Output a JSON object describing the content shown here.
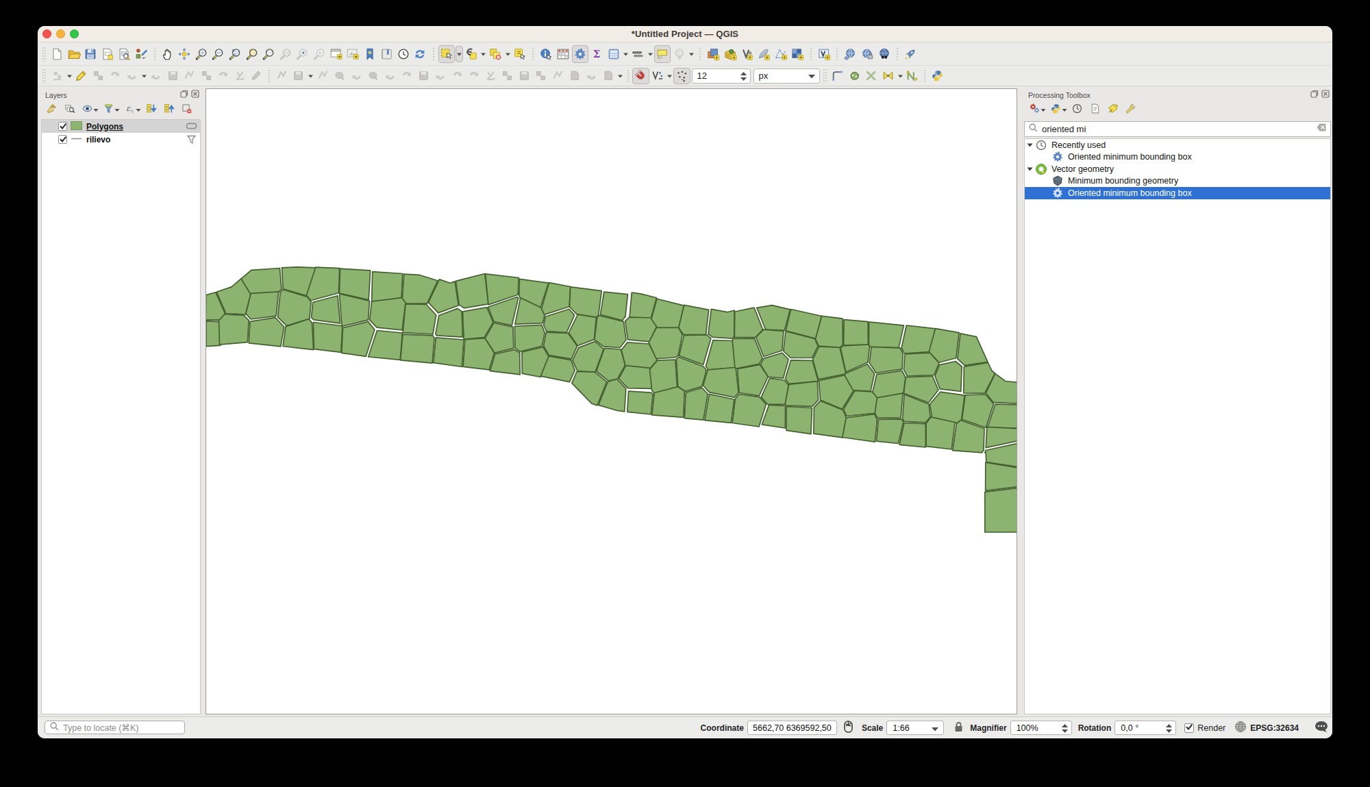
{
  "window": {
    "title": "*Untitled Project — QGIS"
  },
  "traffic_lights": [
    "close",
    "minimize",
    "zoom"
  ],
  "toolbar1": {
    "groups": [
      [
        {
          "icon": "file-new"
        },
        {
          "icon": "folder-open"
        },
        {
          "icon": "save"
        },
        {
          "icon": "new-layout"
        },
        {
          "icon": "layout-manager"
        },
        {
          "icon": "style-manager"
        }
      ],
      [
        {
          "icon": "pan-hand"
        },
        {
          "icon": "pan-selection"
        },
        {
          "icon": "zoom-in"
        },
        {
          "icon": "zoom-out"
        },
        {
          "icon": "zoom-full"
        },
        {
          "icon": "zoom-selection"
        },
        {
          "icon": "zoom-layer"
        },
        {
          "icon": "zoom-native"
        },
        {
          "icon": "zoom-last"
        },
        {
          "icon": "zoom-next"
        },
        {
          "icon": "new-map-view"
        },
        {
          "icon": "new-3d-view"
        },
        {
          "icon": "bookmark"
        },
        {
          "icon": "bookmark-book"
        },
        {
          "icon": "temporal-clock"
        },
        {
          "icon": "refresh"
        }
      ],
      [
        {
          "icon": "select-rect",
          "drop": true,
          "pressed": true
        },
        {
          "icon": "select-expression",
          "drop": true
        },
        {
          "icon": "deselect",
          "drop": true
        },
        {
          "icon": "select-value"
        }
      ],
      [
        {
          "icon": "identify"
        },
        {
          "icon": "attr-table"
        },
        {
          "icon": "processing-gear",
          "pressed": true
        },
        {
          "icon": "stats-sigma"
        },
        {
          "icon": "calc-table",
          "drop": true
        },
        {
          "icon": "measure",
          "drop": true
        },
        {
          "icon": "map-tips",
          "pressed": true
        },
        {
          "icon": "annotation-gray",
          "drop": true
        }
      ],
      [
        {
          "icon": "datasource"
        },
        {
          "icon": "new-gpkg"
        },
        {
          "icon": "new-shapefile"
        },
        {
          "icon": "new-spatialite"
        },
        {
          "icon": "new-mesh"
        },
        {
          "icon": "new-raster"
        }
      ],
      [
        {
          "icon": "new-virtual"
        }
      ],
      [
        {
          "icon": "web-layers"
        },
        {
          "icon": "web-lock"
        },
        {
          "icon": "web-search"
        }
      ],
      [
        {
          "icon": "plugin-rocket"
        }
      ]
    ]
  },
  "toolbar2": {
    "groups1": [
      [
        {
          "icon": "edits-current",
          "drop": true
        },
        {
          "icon": "edit-pencil"
        },
        {
          "icon": "save-edits-gray"
        },
        {
          "icon": "digitize-gray"
        },
        {
          "icon": "vertex-gray",
          "drop": true
        },
        {
          "icon": "form-gray"
        },
        {
          "icon": "paste-gray"
        },
        {
          "icon": "cut-gray"
        },
        {
          "icon": "copy2-gray"
        },
        {
          "icon": "paste2-gray"
        },
        {
          "icon": "undo-gray"
        },
        {
          "icon": "redo-gray"
        }
      ],
      [
        {
          "icon": "chart-gray"
        },
        {
          "icon": "curve-gray",
          "drop": true
        },
        {
          "icon": "reshape-gray"
        },
        {
          "icon": "split-gray"
        },
        {
          "icon": "splitparts-gray"
        },
        {
          "icon": "trim-gray"
        },
        {
          "icon": "merge-gray"
        },
        {
          "icon": "mergeattr-gray"
        },
        {
          "icon": "rotate-gray"
        },
        {
          "icon": "extend-gray"
        },
        {
          "icon": "simplify-gray"
        },
        {
          "icon": "addring-gray"
        },
        {
          "icon": "addpart-gray"
        },
        {
          "icon": "swap-gray"
        },
        {
          "icon": "fillring-gray"
        },
        {
          "icon": "delring-gray"
        },
        {
          "icon": "delpart-gray"
        },
        {
          "icon": "offset-gray"
        },
        {
          "icon": "regular-gray"
        },
        {
          "icon": "move-gray",
          "drop": true
        }
      ],
      [
        {
          "icon": "magnet",
          "pressed": true
        },
        {
          "icon": "snap-type",
          "drop": true
        },
        {
          "icon": "snap-dots",
          "pressed": true
        }
      ]
    ],
    "tolerance_value": "12",
    "units_value": "px",
    "groups2": [
      [
        {
          "icon": "topo-branch"
        },
        {
          "icon": "topo-blob"
        },
        {
          "icon": "topo-x"
        },
        {
          "icon": "topo-bowtie",
          "drop": true
        },
        {
          "icon": "topo-n"
        }
      ],
      [
        {
          "icon": "python-plugin"
        }
      ]
    ]
  },
  "layers_panel": {
    "title": "Layers",
    "toolbar": [
      {
        "icon": "broom-styling"
      },
      {
        "icon": "add-group"
      },
      {
        "icon": "eye-themes",
        "drop": true
      },
      {
        "icon": "filter-funnel",
        "drop": true
      },
      {
        "icon": "filter-expression",
        "drop": true
      },
      {
        "icon": "expand-all"
      },
      {
        "icon": "collapse-all"
      },
      {
        "icon": "remove-layer"
      }
    ],
    "rows": [
      {
        "label": "Polygons",
        "checked": true,
        "symbol": "polygon-swatch",
        "indicator": "memory-indicator",
        "selected": true,
        "underline": true
      },
      {
        "label": "rilievo",
        "checked": true,
        "symbol": "line-swatch",
        "indicator": "filter-indicator",
        "selected": false,
        "underline": false
      }
    ]
  },
  "toolbox_panel": {
    "title": "Processing Toolbox",
    "toolbar": [
      {
        "icon": "models-gears",
        "drop": true
      },
      {
        "icon": "python-small",
        "drop": true
      },
      {
        "icon": "history-clock"
      },
      {
        "icon": "results-doc"
      },
      {
        "icon": "edit-tag"
      },
      {
        "icon": "wrench"
      }
    ],
    "search": {
      "value": "oriented mi"
    },
    "tree": [
      {
        "kind": "group",
        "icon": "clock-small",
        "label": "Recently used",
        "expanded": true
      },
      {
        "kind": "alg",
        "icon": "alg-gear",
        "label": "Oriented minimum bounding box"
      },
      {
        "kind": "group",
        "icon": "qgis-logo",
        "label": "Vector geometry",
        "expanded": true
      },
      {
        "kind": "alg",
        "icon": "min-geom",
        "label": "Minimum bounding geometry"
      },
      {
        "kind": "alg",
        "icon": "alg-gear-sel",
        "label": "Oriented minimum bounding box",
        "selected": true
      }
    ]
  },
  "map": {
    "fill": "#8db370",
    "stroke": "#44602f",
    "stroke_width": 1.7,
    "stones": [
      "313.9,426.8 299.8,430.8 299.2,467.1 319.5,467.2 327.8,458.2",
      "319.5,469.7 299.9,468.9 299.9,505.7 320.5,504.4",
      "351.2,406.7 337.0,418.9 315.1,426.2 328.8,457.5 357.4,459.1 364.9,429.0",
      "362.2,467.6 355.0,460.3 326.8,459.0 318.5,468.0 319.5,503.2 360.4,499.7",
      "410.0,421.8 407.4,391.5 365.8,394.4 351.1,406.9 364.5,429.0 405.4,426.8",
      "405.7,425.9 365.2,428.4 358.0,458.1 365.1,466.0 402.1,461.4",
      "413.7,477.3 401.3,463.7 364.0,469.3 362.2,500.8 408.7,505.8",
      "412.3,421.7 446.9,431.9 460.2,390.8 432.9,389.9 410.4,390.9",
      "417.3,475.6 450.8,465.4 453.2,440.8 447.6,433.4 412.3,422.6 408.1,427.0 404.5,462.9",
      "454.5,471.4 450.1,465.8 416.0,476.9 412.0,505.5 456.6,510.7",
      "446.4,431.0 452.8,438.7 493.4,427.7 494.7,391.6 459.9,390.1",
      "455.8,441.3 453.5,463.6 456.9,466.8 495.6,472.2 492.0,431.7",
      "456.3,470.5 457.4,509.7 496.8,514.4 498.8,477.7 497.1,475.5",
      "537.2,437.8 539.6,394.9 495.5,392.2 494.4,428.1",
      "494.5,429.0 498.0,475.1 499.3,476.2 536.6,467.1 538.4,439.4",
      "497.8,515.4 533.2,520.3 545.9,481.2 536.6,469.6 499.4,478.6",
      "585.1,434.8 586.8,399.5 542.7,396.6 541.6,441.1",
      "538.7,467.2 549.1,478.2 586.1,481.8 591.1,441.4 586.0,434.6 541.6,440.1",
      "549.4,482.5 536.6,521.0 583.2,525.4 586.4,486.0",
      "586.4,435.8 591.6,442.8 622.5,443.1 638.0,409.7 610.8,401.3 588.7,400.1",
      "621.5,444.5 591.1,443.9 587.1,485.6 630.9,488.0 635.7,460.0",
      "583.6,525.8 630.1,530.2 633.1,493.6 630.8,489.8 587.0,488.1",
      "624.4,441.6 638.7,456.9 668.4,446.0 663.0,410.9 656.2,413.3 640.4,407.9",
      "639.7,460.5 634.8,487.9 636.6,489.9 674.3,492.2 673.2,454.9 667.1,450.4",
      "676.0,496.0 635.2,492.8 631.8,529.6 673.4,535.5",
      "676.4,449.9 711.9,443.8 706.8,399.5 664.4,410.4 669.3,445.1",
      "709.8,448.6 674.5,454.8 676.1,495.4 705.9,492.7 719.0,470.8",
      "720.5,515.2 706.9,493.6 677.9,495.7 675.0,535.4 713.2,539.8",
      "756.2,405.5 707.6,399.9 712.0,444.9 755.2,430.3",
      "754.1,433.5 711.6,448.3 720.0,469.7 746.2,475.2 755.6,435.6",
      "719.8,471.5 707.2,493.9 721.2,515.4 748.8,508.4 747.9,477.4",
      "757.7,514.9 750.3,510.4 721.7,517.0 714.4,541.6 758.2,546.8",
      "787.9,449.0 799.8,413.2 757.4,407.4 756.8,431.8 758.0,434.9",
      "794.4,458.6 789.0,449.3 758.8,434.7 750.8,473.4 791.3,471.7",
      "750.3,476.4 750.9,508.1 758.4,513.2 790.4,505.2 794.2,486.1 789.9,474.4",
      "761.3,545.3 788.4,550.5 800.2,520.7 791.9,506.7 760.9,514.0",
      "831.7,418.5 800.5,412.7 789.6,450.7 793.5,459.4 830.1,447.8",
      "796.6,483.7 826.2,485.5 837.6,460.1 829.8,451.2 795.2,462.3 792.6,474.5",
      "792.5,505.0 800.5,518.6 833.2,524.1 841.6,505.3 828.4,486.4 796.4,485.1",
      "838.3,540.5 832.5,525.7 800.2,519.8 788.4,549.1 830.5,557.7",
      "877.3,424.7 831.8,418.9 830.4,448.0 840.8,458.6 869.0,463.1 872.5,461.1",
      "869.5,463.5 842.4,459.1 829.3,485.9 842.3,504.7 866.4,495.6",
      "843.6,507.6 834.7,526.4 842.1,541.7 867.9,543.2 880.3,509.6 867.7,498.4",
      "833.8,559.4 862.7,589.2 870.9,591.9 884.8,557.4 867.2,543.2 841.0,542.5",
      "875.4,459.2 907.3,467.8 912.0,462.4 915.4,429.6 880.8,426.1",
      "874.0,460.6 871.0,462.4 866.9,495.6 879.9,505.9 904.2,507.5 913.0,496.3 909.4,469.3",
      "881.5,508.3 869.5,542.0 887.3,556.2 900.6,553.0 911.6,533.1 905.2,510.0",
      "912.8,567.3 899.7,553.5 886.4,557.3 872.6,591.4 900.1,599.5 910.7,600.9",
      "957.5,434.8 935.3,429.1 921.3,427.2 918.0,463.3 949.4,464.2",
      "950.0,464.0 917.7,463.1 911.7,468.9 915.5,495.9 946.9,498.8 957.6,476.5",
      "914.9,499.9 906.2,510.9 912.2,534.6 947.3,538.7 958.3,525.7 946.4,502.0",
      "902.2,552.9 915.6,566.7 951.0,567.4 947.9,537.4 912.8,533.6",
      "952.2,575.8 949.4,573.2 916.5,571.2 914.8,601.4 949.3,605.0",
      "989.7,478.6 997.4,446.1 958.0,436.2 949.9,465.8 958.5,478.4",
      "946.1,499.9 957.1,523.6 984.5,522.0 989.0,519.6 995.2,488.6 989.5,478.3 957.5,478.3",
      "947.5,539.4 950.7,570.0 953.8,574.3 987.6,565.4 984.8,525.2 958.6,526.1",
      "988.4,564.6 954.2,573.5 950.8,605.8 996.9,609.3 998.2,570.8",
      "989.8,478.5 996.7,488.5 1029.6,488.6 1033.7,452.4 997.7,445.3",
      "1025.7,532.5 1036.9,493.9 1030.6,488.9 997.5,489.6 990.4,519.3",
      "986.4,524.2 988.7,564.1 999.7,571.4 1023.8,564.1 1030.2,540.5 1026.1,535.3 990.2,521.2",
      "1000.1,573.3 998.3,610.7 1025.9,613.2 1032.2,575.0 1023.8,566.1",
      "1032.9,487.7 1039.5,492.4 1068.2,494.1 1070.7,491.6 1071.1,453.0 1060.7,455.7 1037.4,451.4",
      "1029.3,535.0 1033.2,540.1 1073.0,536.7 1068.2,497.5 1039.9,496.7",
      "1072.0,536.5 1032.3,539.8 1025.4,562.7 1034.2,572.6 1071.1,580.1 1077.1,573.2 1073.2,537.2",
      "1070.8,583.0 1034.4,575.3 1027.8,613.6 1066.4,617.3",
      "1100.1,449.2 1071.7,455.0 1071.3,492.7 1101.9,492.6 1112.6,481.1",
      "1069.6,494.3 1068.2,496.9 1071.9,536.7 1073.5,538.2 1107.2,531.3 1112.0,522.7 1100.4,494.1",
      "1108.4,532.3 1075.5,538.7 1078.1,573.5 1107.3,577.9 1120.2,550.1",
      "1117.4,590.3 1107.9,579.6 1077.7,575.5 1072.3,582.6 1068.1,617.5 1107.0,623.0",
      "1116.5,481.0 1144.3,482.3 1152.4,451.9 1125.9,445.6 1103.8,449.3",
      "1143.0,483.5 1113.9,481.1 1102.4,492.3 1113.9,520.5 1140.5,512.0",
      "1140.7,515.2 1113.7,523.4 1109.2,532.3 1120.6,550.3 1142.4,552.1 1150.2,524.6",
      "1144.1,555.0 1122.5,552.3 1110.3,579.9 1119.3,590.2 1145.3,590.3 1150.2,562.7",
      "1121.6,591.1 1111.3,619.8 1145.3,625.0 1145.5,592.4",
      "1146.0,482.9 1189.8,494.4 1198.5,461.5 1153.7,451.5",
      "1145.9,483.8 1142.6,512.5 1153.0,522.4 1184.5,522.5 1193.1,505.2 1188.7,494.8",
      "1193.5,556.5 1185.0,526.3 1153.5,525.9 1145.3,553.1 1150.6,560.4",
      "1150.5,561.3 1145.2,589.7 1147.3,592.2 1184.7,593.3 1193.5,584.1 1192.3,556.7",
      "1184.5,595.5 1147.1,593.5 1147.0,628.4 1182.9,633.6",
      "1229.0,465.1 1198.8,461.3 1189.4,495.1 1194.1,505.1 1225.2,507.4 1229.4,503.5",
      "1233.4,543.5 1225.0,507.5 1194.7,506.0 1185.5,524.7 1193.7,553.9 1232.5,546.2",
      "1232.3,547.7 1194.4,555.7 1196.5,584.1 1228.5,597.2 1245.3,570.0",
      "1234.3,609.7 1229.8,598.8 1196.7,585.2 1187.4,594.7 1186.8,633.2 1229.1,638.9",
      "1266.4,503.2 1266.2,469.6 1231.0,466.7 1230.5,504.0",
      "1226.1,507.9 1233.8,543.2 1266.0,529.0 1268.6,505.6 1266.8,503.0 1230.1,504.9",
      "1269.9,571.2 1275.6,545.5 1265.4,531.7 1233.2,545.2 1231.7,547.4 1244.4,569.9",
      "1230.2,597.7 1235.0,607.5 1276.4,603.4 1280.2,580.2 1272.0,571.9 1247.1,570.3",
      "1279.5,612.2 1275.6,604.7 1234.2,609.8 1228.8,638.5 1276.3,645.1",
      "1267.4,503.7 1269.3,506.3 1311.1,507.6 1318.4,475.1 1267.5,470.0",
      "1277.9,544.5 1315.9,538.9 1317.3,516.6 1313.2,508.1 1271.0,506.5 1268.2,529.8",
      "1272.8,572.3 1280.0,581.2 1317.8,574.3 1320.9,551.0 1315.8,541.1 1278.8,546.7",
      "1276.2,602.8 1280.1,610.3 1314.1,609.9 1317.0,574.1 1279.5,580.6",
      "1281.4,612.3 1278.4,644.2 1310.4,647.5 1318.0,615.2 1314.6,611.9",
      "1315.0,508.0 1319.6,516.1 1356.2,513.6 1364.7,479.8 1322.3,475.0",
      "1323.4,549.0 1362.6,547.5 1369.9,530.0 1356.6,515.1 1320.1,517.0 1318.3,539.7",
      "1318.5,574.2 1354.6,588.0 1368.8,569.4 1360.5,549.2 1321.1,550.6",
      "1319.4,615.3 1350.5,616.9 1357.2,608.6 1354.9,590.0 1319.0,575.8 1316.5,611.7",
      "1312.1,649.4 1350.4,653.0 1350.2,618.6 1318.9,617.5",
      "1394.7,522.8 1399.1,485.6 1364.6,479.6 1355.2,513.5 1369.9,529.2",
      "1363.8,548.8 1371.1,567.9 1401.8,571.4 1403.1,535.0 1394.1,527.5 1370.6,532.7",
      "1396.0,617.6 1402.7,612.3 1407.1,577.1 1371.7,572.2 1356.6,590.0 1359.4,609.1",
      "1393.1,616.5 1358.0,609.0 1351.0,618.1 1351.1,651.7 1388.2,656.0",
      "1407.2,533.3 1441.0,528.6 1424.4,491.6 1401.0,486.8 1396.8,523.8",
      "1406.3,535.3 1405.7,573.8 1436.5,574.1 1451.6,545.1 1446.8,541.0 1441.3,529.3",
      "1437.6,576.0 1408.1,576.7 1403.4,612.3 1438.3,624.2 1449.6,589.6",
      "1401.6,613.6 1395.3,618.6 1389.7,657.6 1432.7,660.9 1435.0,657.0 1436.0,625.5",
      "1438.2,573.9 1448.9,587.3 1483.6,589.2 1484.3,558.3 1466.8,556.5 1451.8,545.4",
      "1452.0,590.1 1440.6,623.9 1486.6,625.3 1486.1,591.1",
      "1439.7,623.4 1438.2,653.7 1486.5,643.5 1486.2,625.9",
      "1436.7,660.8 1438.1,660.5 1438.8,674.6 1486.1,681.8 1486.4,647.0 1437.8,657.5",
      "1437.8,675.1 1437.6,716.4 1484.4,710.7 1484.8,683.0",
      "1436.7,718.4 1436.8,776.9 1484.3,777.0 1484.8,712.4"
    ]
  },
  "statusbar": {
    "locate_placeholder": "Type to locate (⌘K)",
    "coordinate_label": "Coordinate",
    "coordinate_value": "5662,70 6369592,50",
    "scale_label": "Scale",
    "scale_value": "1:66",
    "magnifier_label": "Magnifier",
    "magnifier_value": "100%",
    "rotation_label": "Rotation",
    "rotation_value": "0,0 °",
    "render_label": "Render",
    "crs_label": "EPSG:32634"
  },
  "colors": {
    "selection_blue": "#2e71d2",
    "stone_fill": "#8db370",
    "stone_stroke": "#44602f"
  },
  "icons": {
    "search": "search-small",
    "clear": "clear-circle",
    "panel_float": "panel-float",
    "panel_close": "panel-close",
    "extents": "extents-mouse",
    "lock": "lock",
    "globe": "globe-crs",
    "messages": "message-bubble",
    "spin": "spin-updown",
    "combo_arrow": "drop-arrow-big",
    "check": "check-small"
  }
}
